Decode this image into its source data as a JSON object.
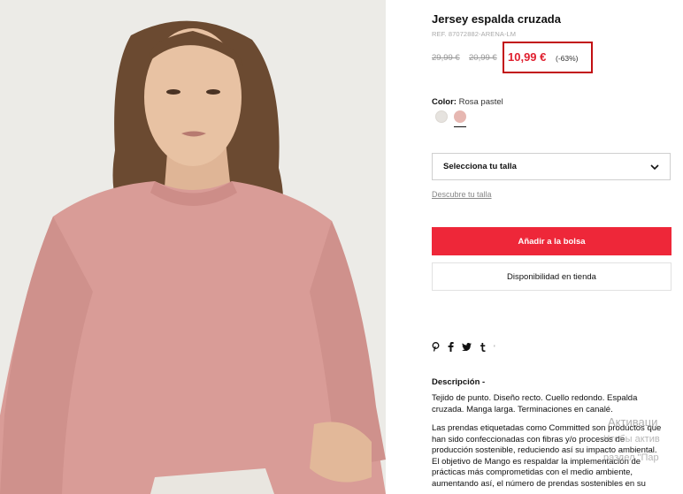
{
  "product": {
    "title": "Jersey espalda cruzada",
    "ref": "REF. 87072882-ARENA-LM",
    "old_price_1": "29,99 €",
    "old_price_2": "20,99 €",
    "price": "10,99 €",
    "discount": "(-63%)"
  },
  "color": {
    "label": "Color:",
    "selected": "Rosa pastel",
    "swatches": [
      "#e6e3df",
      "#e6b7b1"
    ]
  },
  "size": {
    "placeholder": "Selecciona tu talla",
    "guide_link": "Descubre tu talla"
  },
  "actions": {
    "add_to_bag": "Añadir a la bolsa",
    "store_availability": "Disponibilidad en tienda"
  },
  "share_icons": [
    "pinterest-icon",
    "facebook-icon",
    "twitter-icon",
    "tumblr-icon"
  ],
  "description": {
    "title": "Descripción  -",
    "paragraph_1": "Tejido de punto. Diseño recto. Cuello redondo. Espalda cruzada. Manga larga. Terminaciones en canalé.",
    "paragraph_2": "Las prendas etiquetadas como Committed son productos que han sido confeccionadas con fibras y/o procesos de producción sostenible, reduciendo así su impacto ambiental. El objetivo de Mango es respaldar la implementación de prácticas más comprometidas con el medio ambiente, aumentando así, el número de prendas sostenibles en su"
  },
  "watermark": {
    "line1": "Активаци",
    "line2": "Чтобы актив",
    "line3": "раздел \"Пар"
  },
  "colors": {
    "accent": "#ee2739",
    "price_red": "#e0202f",
    "highlight_border": "#c20f12"
  }
}
